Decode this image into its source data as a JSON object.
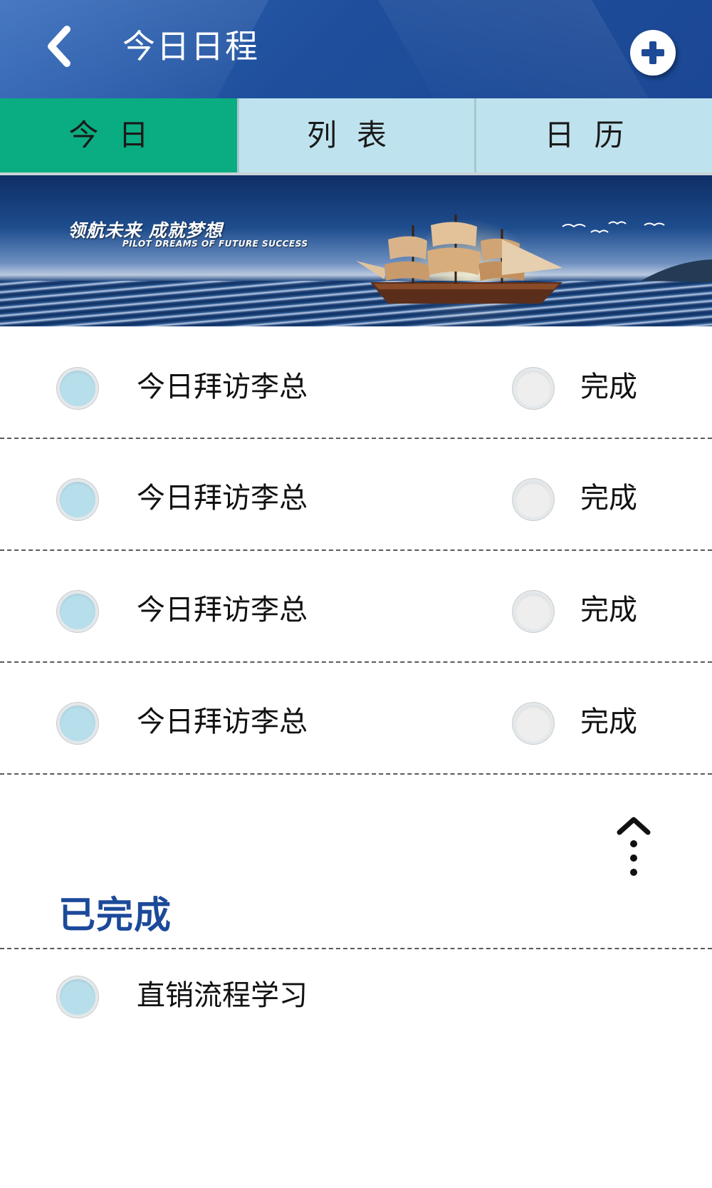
{
  "header": {
    "title": "今日日程",
    "back_icon": "chevron-left-icon",
    "add_icon": "plus-circle-icon"
  },
  "tabs": [
    {
      "label": "今日",
      "active": true
    },
    {
      "label": "列表",
      "active": false
    },
    {
      "label": "日历",
      "active": false
    }
  ],
  "banner": {
    "title": "领航未来  成就梦想",
    "subtitle": "PILOT DREAMS OF FUTURE SUCCESS"
  },
  "todo": [
    {
      "label": "今日拜访李总",
      "action": "完成"
    },
    {
      "label": "今日拜访李总",
      "action": "完成"
    },
    {
      "label": "今日拜访李总",
      "action": "完成"
    },
    {
      "label": "今日拜访李总",
      "action": "完成"
    }
  ],
  "collapse_icon": "collapse-up-icon",
  "completed": {
    "title": "已完成",
    "items": [
      {
        "label": "直销流程学习"
      }
    ]
  },
  "colors": {
    "header": "#1f4f9c",
    "tab_active": "#0aad82",
    "tab_inactive": "#bfe3ee",
    "section_title": "#1c4a9a"
  }
}
